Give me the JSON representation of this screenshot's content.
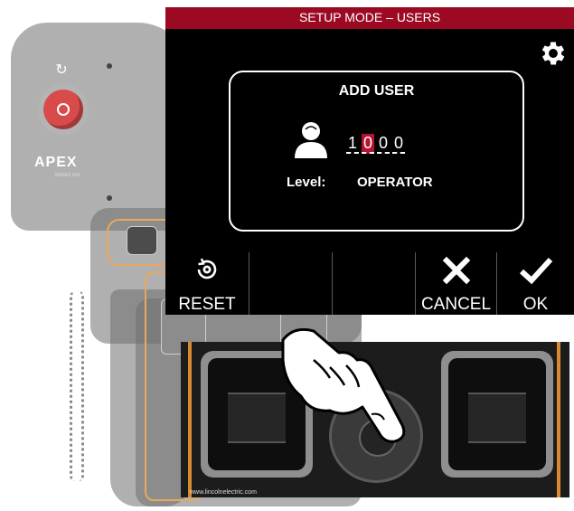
{
  "device": {
    "brand": "APEX",
    "brand_sub": "SERIES HW"
  },
  "screen": {
    "title": "SETUP MODE –  USERS",
    "settings_icon": "gear-icon",
    "dialog": {
      "title": "ADD USER",
      "user_icon": "user-icon",
      "pin_digits": [
        "1",
        "0",
        "0",
        "0"
      ],
      "active_digit_index": 1,
      "level_label": "Level:",
      "level_value": "OPERATOR"
    },
    "softkeys": [
      {
        "label": "RESET",
        "icon": "reset-icon"
      },
      {
        "label": "",
        "icon": ""
      },
      {
        "label": "",
        "icon": ""
      },
      {
        "label": "CANCEL",
        "icon": "close-icon"
      },
      {
        "label": "OK",
        "icon": "check-icon"
      }
    ]
  },
  "photo": {
    "url_text": "www.lincolnelectric.com"
  },
  "colors": {
    "title_bar": "#9b0a22",
    "active_digit": "#b3142f",
    "trim": "#d98a2e"
  }
}
